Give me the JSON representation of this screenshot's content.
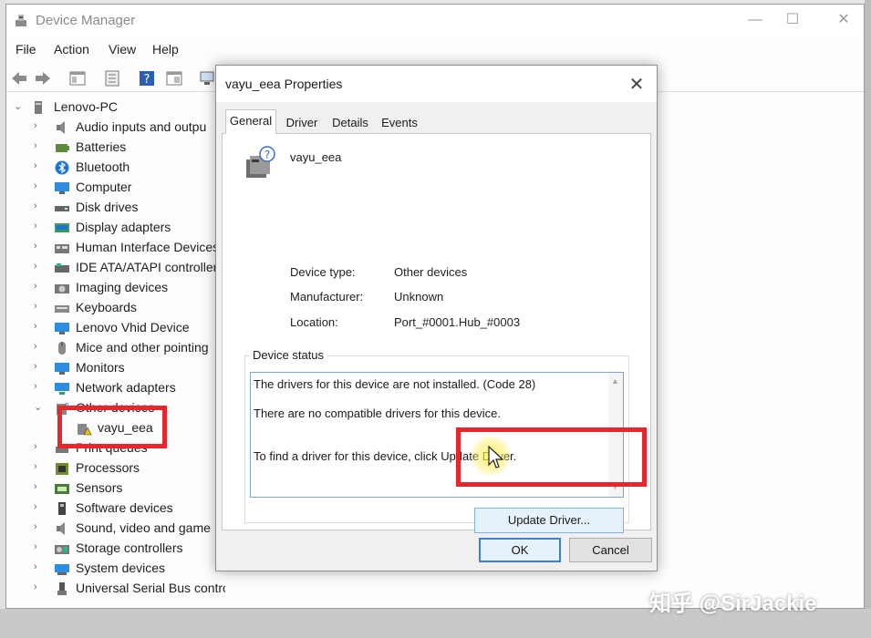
{
  "window": {
    "title": "Device Manager",
    "controls": {
      "minimize": "—",
      "maximize": "☐",
      "close": "✕"
    }
  },
  "menu": [
    "File",
    "Action",
    "View",
    "Help"
  ],
  "tree": {
    "root": "Lenovo-PC",
    "items": [
      {
        "label": "Audio inputs and outpu",
        "icon": "speaker-icon"
      },
      {
        "label": "Batteries",
        "icon": "battery-icon"
      },
      {
        "label": "Bluetooth",
        "icon": "bluetooth-icon"
      },
      {
        "label": "Computer",
        "icon": "monitor-icon"
      },
      {
        "label": "Disk drives",
        "icon": "disk-icon"
      },
      {
        "label": "Display adapters",
        "icon": "display-adapter-icon"
      },
      {
        "label": "Human Interface Devices",
        "icon": "hid-icon"
      },
      {
        "label": "IDE ATA/ATAPI controllers",
        "icon": "ide-icon"
      },
      {
        "label": "Imaging devices",
        "icon": "camera-icon"
      },
      {
        "label": "Keyboards",
        "icon": "keyboard-icon"
      },
      {
        "label": "Lenovo Vhid Device",
        "icon": "monitor-icon"
      },
      {
        "label": "Mice and other pointing",
        "icon": "mouse-icon"
      },
      {
        "label": "Monitors",
        "icon": "monitor-icon"
      },
      {
        "label": "Network adapters",
        "icon": "network-icon"
      },
      {
        "label": "Other devices",
        "icon": "unknown-device-icon",
        "expanded": true
      },
      {
        "label": "vayu_eea",
        "icon": "warning-device-icon",
        "child": true
      },
      {
        "label": "Print queues",
        "icon": "printer-icon"
      },
      {
        "label": "Processors",
        "icon": "cpu-icon"
      },
      {
        "label": "Sensors",
        "icon": "sensor-icon"
      },
      {
        "label": "Software devices",
        "icon": "software-device-icon"
      },
      {
        "label": "Sound, video and game",
        "icon": "speaker-icon"
      },
      {
        "label": "Storage controllers",
        "icon": "storage-icon"
      },
      {
        "label": "System devices",
        "icon": "system-icon"
      },
      {
        "label": "Universal Serial Bus controllers",
        "icon": "usb-icon"
      }
    ]
  },
  "dialog": {
    "title": "vayu_eea Properties",
    "tabs": [
      "General",
      "Driver",
      "Details",
      "Events"
    ],
    "active_tab": "General",
    "device_name": "vayu_eea",
    "properties": [
      {
        "label": "Device type:",
        "value": "Other devices"
      },
      {
        "label": "Manufacturer:",
        "value": "Unknown"
      },
      {
        "label": "Location:",
        "value": "Port_#0001.Hub_#0003"
      }
    ],
    "status_group_label": "Device status",
    "status_lines": [
      "The drivers for this device are not installed. (Code 28)",
      "There are no compatible drivers for this device.",
      "To find a driver for this device, click Update Driver."
    ],
    "update_button": "Update Driver...",
    "ok_button": "OK",
    "cancel_button": "Cancel"
  },
  "watermark": "知乎 @SirJackie",
  "colors": {
    "highlight": "#e8262b",
    "accent": "#3d7fd0"
  }
}
